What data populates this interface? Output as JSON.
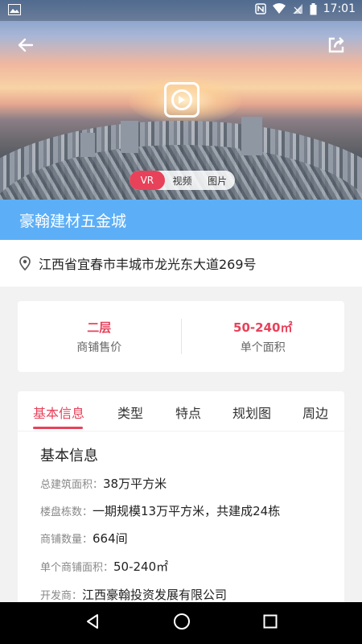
{
  "status_bar": {
    "time": "17:01"
  },
  "hero": {
    "media_tabs": [
      "VR",
      "视频",
      "图片"
    ],
    "active_media_tab": "VR"
  },
  "title": "豪翰建材五金城",
  "address": "江西省宜春市丰城市龙光东大道269号",
  "price": {
    "left_value": "二层",
    "left_label": "商铺售价",
    "right_value": "50-240㎡",
    "right_label": "单个面积"
  },
  "tabs": [
    "基本信息",
    "类型",
    "特点",
    "规划图",
    "周边"
  ],
  "active_tab": "基本信息",
  "basic_info": {
    "section_title": "基本信息",
    "rows": [
      {
        "key": "总建筑面积：",
        "value": "38万平方米"
      },
      {
        "key": "楼盘栋数：",
        "value": "一期规模13万平方米，共建成24栋"
      },
      {
        "key": "商铺数量：",
        "value": "664间"
      },
      {
        "key": "单个商铺面积：",
        "value": "50-240㎡"
      },
      {
        "key": "开发商：",
        "value": "江西豪翰投资发展有限公司"
      }
    ]
  },
  "colors": {
    "accent": "#e8415a",
    "title_bar": "#5caff7"
  }
}
